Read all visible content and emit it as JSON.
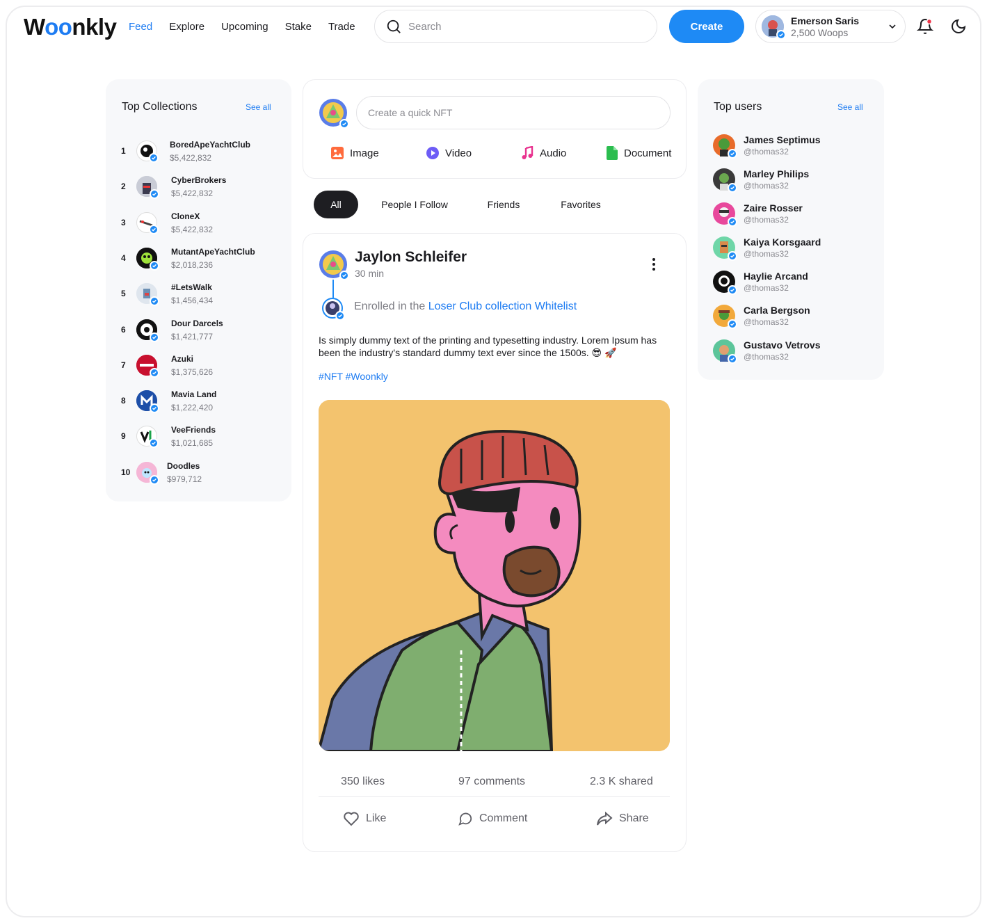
{
  "header": {
    "logo_prefix": "W",
    "logo_oo": "oo",
    "logo_suffix": "nkly",
    "nav": [
      "Feed",
      "Explore",
      "Upcoming",
      "Stake",
      "Trade"
    ],
    "active_nav": "Feed",
    "search_placeholder": "Search",
    "create_label": "Create",
    "user": {
      "name": "Emerson Saris",
      "coins": "2,500 Woops"
    }
  },
  "collections": {
    "title": "Top Collections",
    "see_all": "See all",
    "items": [
      {
        "rank": "1",
        "name": "BoredApeYachtClub",
        "value": "$5,422,832"
      },
      {
        "rank": "2",
        "name": "CyberBrokers",
        "value": "$5,422,832"
      },
      {
        "rank": "3",
        "name": "CloneX",
        "value": "$5,422,832"
      },
      {
        "rank": "4",
        "name": "MutantApeYachtClub",
        "value": "$2,018,236"
      },
      {
        "rank": "5",
        "name": "#LetsWalk",
        "value": "$1,456,434"
      },
      {
        "rank": "6",
        "name": "Dour Darcels",
        "value": "$1,421,777"
      },
      {
        "rank": "7",
        "name": "Azuki",
        "value": "$1,375,626"
      },
      {
        "rank": "8",
        "name": "Mavia Land",
        "value": "$1,222,420"
      },
      {
        "rank": "9",
        "name": "VeeFriends",
        "value": "$1,021,685"
      },
      {
        "rank": "10",
        "name": "Doodles",
        "value": "$979,712"
      }
    ]
  },
  "composer": {
    "placeholder": "Create a quick NFT",
    "buttons": [
      "Image",
      "Video",
      "Audio",
      "Document"
    ]
  },
  "tabs": [
    "All",
    "People I Follow",
    "Friends",
    "Favorites"
  ],
  "active_tab": "All",
  "post": {
    "author": "Jaylon Schleifer",
    "time": "30 min",
    "enrolled_prefix": "Enrolled in the ",
    "enrolled_link": "Loser Club collection Whitelist",
    "body": "Is simply dummy text of the printing and typesetting industry. Lorem Ipsum has been the industry's standard dummy text ever since the 1500s. 😎 🚀",
    "tags": "#NFT #Woonkly",
    "likes": "350 likes",
    "comments": "97 comments",
    "shared": "2.3 K shared",
    "actions": {
      "like": "Like",
      "comment": "Comment",
      "share": "Share"
    }
  },
  "top_users": {
    "title": "Top users",
    "see_all": "See all",
    "items": [
      {
        "name": "James Septimus",
        "handle": "@thomas32"
      },
      {
        "name": "Marley Philips",
        "handle": "@thomas32"
      },
      {
        "name": "Zaire Rosser",
        "handle": "@thomas32"
      },
      {
        "name": "Kaiya Korsgaard",
        "handle": "@thomas32"
      },
      {
        "name": "Haylie Arcand",
        "handle": "@thomas32"
      },
      {
        "name": "Carla Bergson",
        "handle": "@thomas32"
      },
      {
        "name": "Gustavo Vetrovs",
        "handle": "@thomas32"
      }
    ]
  },
  "colors": {
    "accent": "#1e8af5",
    "panel": "#f7f8fa",
    "art_bg": "#f3c36e"
  }
}
